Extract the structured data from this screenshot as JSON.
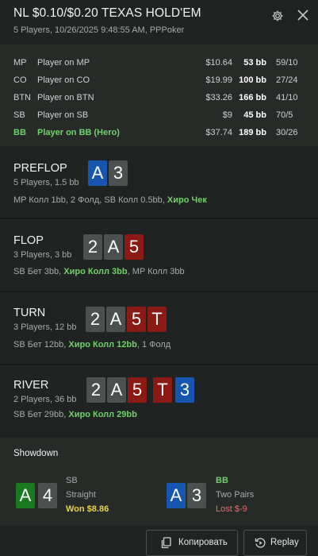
{
  "header": {
    "title": "NL $0.10/$0.20 TEXAS HOLD'EM",
    "subtitle": "5 Players, 10/26/2025 9:48:55 AM, PPPoker"
  },
  "players": [
    {
      "pos": "MP",
      "name": "Player on MP",
      "stack": "$10.64",
      "bb": "53 bb",
      "stat": "59/10"
    },
    {
      "pos": "CO",
      "name": "Player on CO",
      "stack": "$19.99",
      "bb": "100 bb",
      "stat": "27/24"
    },
    {
      "pos": "BTN",
      "name": "Player on BTN",
      "stack": "$33.26",
      "bb": "166 bb",
      "stat": "41/10"
    },
    {
      "pos": "SB",
      "name": "Player on SB",
      "stack": "$9",
      "bb": "45 bb",
      "stat": "70/5"
    },
    {
      "pos": "BB",
      "name": "Player on BB (Hero)",
      "stack": "$37.74",
      "bb": "189 bb",
      "stat": "30/26"
    }
  ],
  "streets": {
    "preflop": {
      "name": "PREFLOP",
      "info": "5 Players, 1.5 bb",
      "cards": [
        "A",
        "3"
      ],
      "actions": "MP Колл 1bb, 2 Фолд, SB Колл 0.5bb, ",
      "hero_action": "Хиро Чек"
    },
    "flop": {
      "name": "FLOP",
      "info": "3 Players, 3 bb",
      "cards": [
        "2",
        "A",
        "5"
      ],
      "actions_before": "SB Бет 3bb, ",
      "hero_action": "Хиро Колл 3bb",
      "actions_after": ", MP Колл 3bb"
    },
    "turn": {
      "name": "TURN",
      "info": "3 Players, 12 bb",
      "cards": [
        "2",
        "A",
        "5",
        "T"
      ],
      "actions_before": "SB Бет 12bb, ",
      "hero_action": "Хиро Колл 12bb",
      "actions_after": ", 1 Фолд"
    },
    "river": {
      "name": "RIVER",
      "info": "2 Players, 36 bb",
      "cards": [
        "2",
        "A",
        "5",
        "T",
        "3"
      ],
      "actions_before": "SB Бет 29bb, ",
      "hero_action": "Хиро Колл 29bb"
    }
  },
  "showdown": {
    "title": "Showdown",
    "hands": [
      {
        "cards": [
          "A",
          "4"
        ],
        "pos": "SB",
        "hand": "Straight",
        "result": "Won $8.86"
      },
      {
        "cards": [
          "A",
          "3"
        ],
        "pos": "BB",
        "hand": "Two Pairs",
        "result": "Lost $-9"
      }
    ]
  },
  "footer": {
    "copy_label": "Копировать",
    "replay_label": "Replay"
  },
  "colors": {
    "background": "#1f2321",
    "panel": "#262b28",
    "hero_green": "#6fd36a",
    "won_yellow": "#e8d24c",
    "lost_red": "#e36f6f",
    "card_blue": "#1656b0",
    "card_grey": "#4c504e",
    "card_red": "#8a1a13",
    "card_green": "#1a7a1f"
  },
  "icons": {
    "settings": "gear-icon",
    "close": "close-icon",
    "copy": "copy-icon",
    "replay": "replay-icon"
  }
}
